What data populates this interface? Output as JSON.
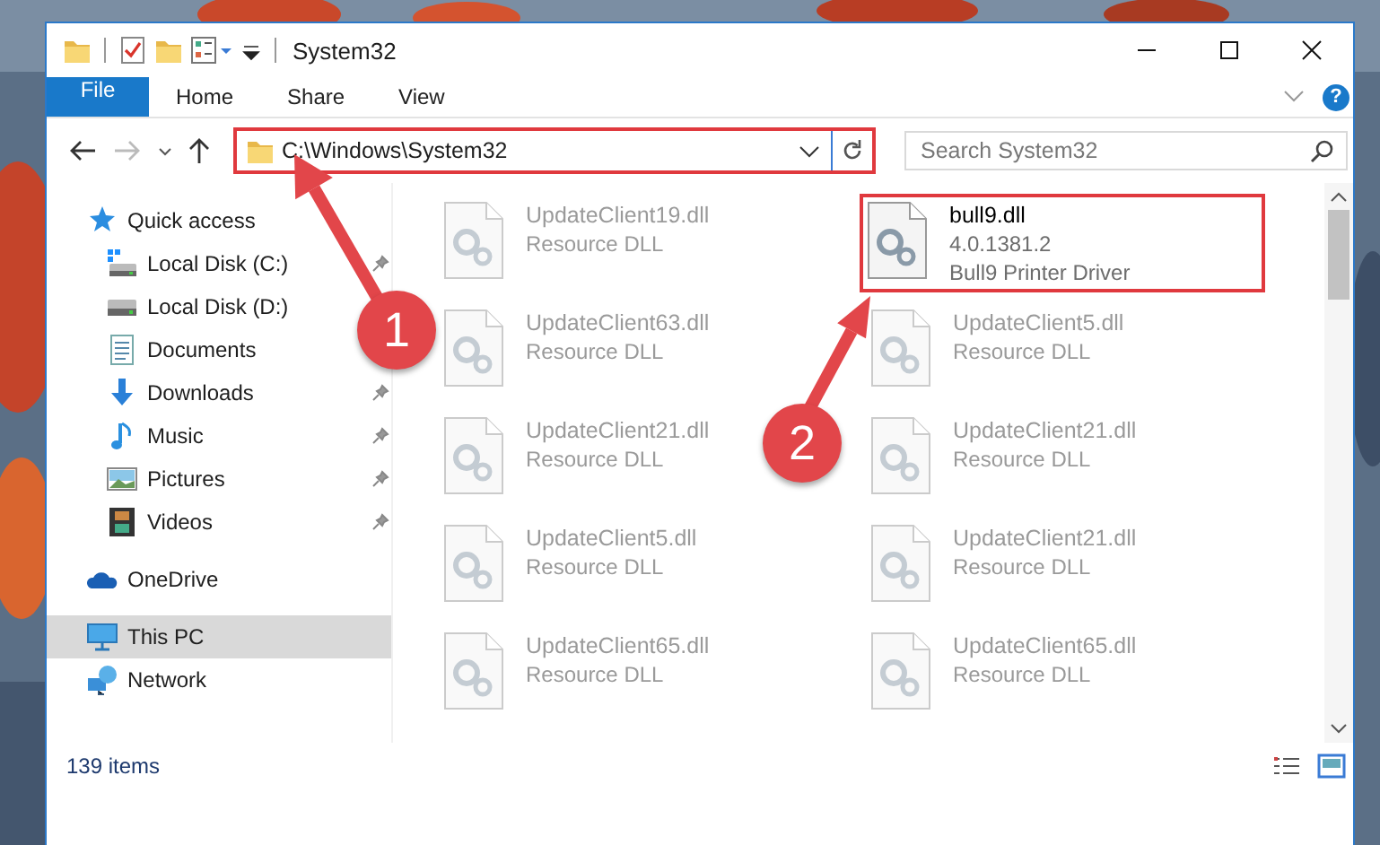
{
  "window": {
    "title": "System32"
  },
  "ribbon": {
    "tabs": [
      {
        "label": "File",
        "kind": "file",
        "selected": false
      },
      {
        "label": "Home",
        "kind": "tab",
        "selected": false
      },
      {
        "label": "Share",
        "kind": "tab",
        "selected": false
      },
      {
        "label": "View",
        "kind": "tab",
        "selected": false
      }
    ],
    "help": "?"
  },
  "address_bar": {
    "path": "C:\\Windows\\System32",
    "highlighted": true
  },
  "search": {
    "placeholder": "Search System32"
  },
  "sidebar": {
    "items": [
      {
        "label": "Quick access",
        "kind": "star",
        "selected": false,
        "children": [
          {
            "label": "Local Disk (C:)",
            "kind": "windows-drive",
            "pinned": true,
            "selected": false
          },
          {
            "label": "Local Disk (D:)",
            "kind": "drive",
            "selected": false
          },
          {
            "label": "Documents",
            "kind": "documents",
            "selected": false
          },
          {
            "label": "Downloads",
            "kind": "downloads",
            "pinned": true,
            "selected": false
          },
          {
            "label": "Music",
            "kind": "music",
            "pinned": true,
            "selected": false
          },
          {
            "label": "Pictures",
            "kind": "pictures",
            "pinned": true,
            "selected": false
          },
          {
            "label": "Videos",
            "kind": "videos",
            "pinned": true,
            "selected": false
          }
        ]
      },
      {
        "label": "OneDrive",
        "kind": "cloud",
        "selected": false
      },
      {
        "label": "This PC",
        "kind": "computer",
        "selected": true
      },
      {
        "label": "Network",
        "kind": "network",
        "selected": false
      }
    ]
  },
  "files": [
    {
      "name": "UpdateClient19.dll",
      "details": [
        "Resource DLL"
      ],
      "blurred": true,
      "highlighted": false
    },
    {
      "name": "bull9.dll",
      "details": [
        "4.0.1381.2",
        "Bull9 Printer Driver"
      ],
      "blurred": false,
      "highlighted": true
    },
    {
      "name": "UpdateClient63.dll",
      "details": [
        "Resource DLL"
      ],
      "blurred": true,
      "highlighted": false
    },
    {
      "name": "UpdateClient5.dll",
      "details": [
        "Resource DLL"
      ],
      "blurred": true,
      "highlighted": false
    },
    {
      "name": "UpdateClient21.dll",
      "details": [
        "Resource DLL"
      ],
      "blurred": true,
      "highlighted": false
    },
    {
      "name": "UpdateClient21.dll",
      "details": [
        "Resource DLL"
      ],
      "blurred": true,
      "highlighted": false
    },
    {
      "name": "UpdateClient5.dll",
      "details": [
        "Resource DLL"
      ],
      "blurred": true,
      "highlighted": false
    },
    {
      "name": "UpdateClient21.dll",
      "details": [
        "Resource DLL"
      ],
      "blurred": true,
      "highlighted": false
    },
    {
      "name": "UpdateClient65.dll",
      "details": [
        "Resource DLL"
      ],
      "blurred": true,
      "highlighted": false
    },
    {
      "name": "UpdateClient65.dll",
      "details": [
        "Resource DLL"
      ],
      "blurred": true,
      "highlighted": false
    }
  ],
  "status_bar": {
    "item_count": "139 items"
  },
  "annotations": [
    {
      "number": "1"
    },
    {
      "number": "2"
    }
  ]
}
